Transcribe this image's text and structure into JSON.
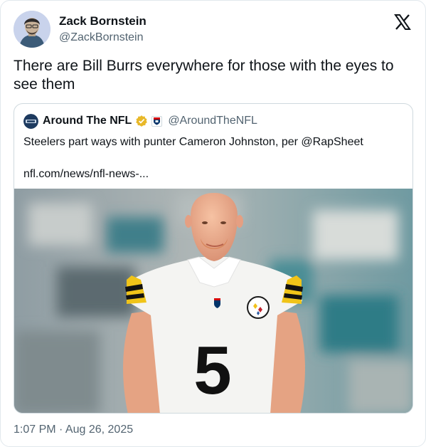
{
  "tweet": {
    "author": {
      "name": "Zack Bornstein",
      "handle": "@ZackBornstein"
    },
    "text": "There are Bill Burrs everywhere for those with the eyes to see them",
    "timestamp": "1:07 PM · Aug 26, 2025"
  },
  "quote": {
    "author": {
      "name": "Around The NFL",
      "handle": "@AroundTheNFL"
    },
    "text": "Steelers part ways with punter Cameron Johnston, per @RapSheet",
    "link": "nfl.com/news/nfl-news-...",
    "image": {
      "jersey_number": "5"
    }
  },
  "icons": {
    "platform": "x-logo-icon",
    "verified": "verified-badge-icon",
    "affiliation": "nfl-affiliate-badge-icon"
  },
  "colors": {
    "text_primary": "#0f1419",
    "text_secondary": "#536471",
    "border": "#cfd9de",
    "verified_gold": "#e8b829"
  }
}
